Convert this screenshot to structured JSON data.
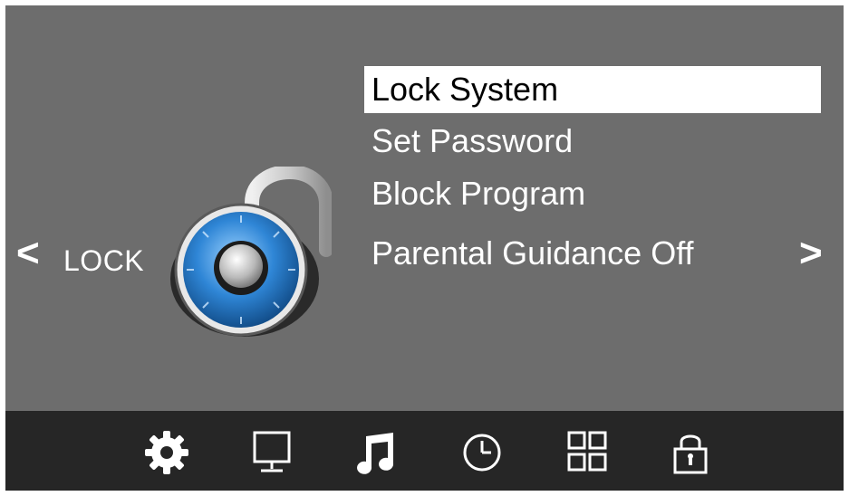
{
  "header": {
    "section_label": "LOCK",
    "nav_left": "<",
    "nav_right": ">"
  },
  "menu": {
    "items": [
      {
        "label": "Lock System",
        "selected": true
      },
      {
        "label": "Set Password",
        "selected": false
      },
      {
        "label": "Block Program",
        "selected": false
      },
      {
        "label": "Parental Guidance Off",
        "selected": false
      }
    ]
  },
  "bottom_bar": {
    "tabs": [
      {
        "icon": "gear-icon",
        "active": true
      },
      {
        "icon": "monitor-icon",
        "active": false
      },
      {
        "icon": "music-note-icon",
        "active": true
      },
      {
        "icon": "clock-icon",
        "active": false
      },
      {
        "icon": "grid-icon",
        "active": false
      },
      {
        "icon": "lock-icon",
        "active": false
      }
    ]
  },
  "colors": {
    "background": "#6d6d6d",
    "bottom_bar": "#262626",
    "highlight": "#ffffff",
    "text": "#ffffff",
    "lock_blue": "#2f86d6"
  }
}
